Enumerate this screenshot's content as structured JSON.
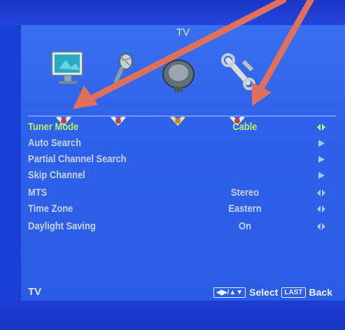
{
  "menu": {
    "title": "TV",
    "categories": [
      {
        "name": "picture",
        "icon": "monitor-icon"
      },
      {
        "name": "sound",
        "icon": "microphone-icon"
      },
      {
        "name": "tv",
        "icon": "satellite-dish-icon"
      },
      {
        "name": "setup",
        "icon": "wrench-icon"
      }
    ],
    "items": [
      {
        "label": "Tuner Mode",
        "value": "Cable",
        "indicator": "left-right",
        "active": true
      },
      {
        "label": "Auto Search",
        "value": "",
        "indicator": "right"
      },
      {
        "label": "Partial Channel Search",
        "value": "",
        "indicator": "right"
      },
      {
        "label": "Skip Channel",
        "value": "",
        "indicator": "right"
      },
      {
        "label": "MTS",
        "value": "Stereo",
        "indicator": "left-right"
      },
      {
        "label": "Time Zone",
        "value": "Eastern",
        "indicator": "left-right"
      },
      {
        "label": "Daylight Saving",
        "value": "On",
        "indicator": "left-right"
      }
    ],
    "footer": {
      "source": "TV",
      "select_key": "◀▶/▲▼",
      "select_label": "Select",
      "back_key": "LAST",
      "back_label": "Back"
    }
  },
  "colors": {
    "screen_bg": "#2f62ea",
    "active_text": "#b8f06a",
    "text": "#c4d3ff",
    "annotation_arrow": "#e0705a"
  }
}
